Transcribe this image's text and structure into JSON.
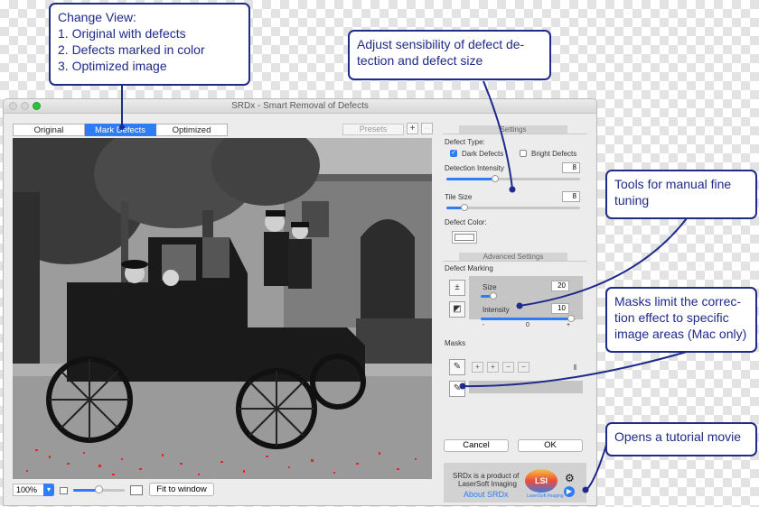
{
  "window": {
    "title": "SRDx - Smart Removal of Defects"
  },
  "tabs": [
    {
      "label": "Original",
      "active": false
    },
    {
      "label": "Mark Defects",
      "active": true
    },
    {
      "label": "Optimized",
      "active": false
    }
  ],
  "toolbar": {
    "presets_label": "Presets",
    "add_label": "+",
    "more_label": "···"
  },
  "settings": {
    "section_title": "Settings",
    "defect_type_label": "Defect Type:",
    "dark_defects_label": "Dark Defects",
    "dark_defects_checked": true,
    "bright_defects_label": "Bright Defects",
    "bright_defects_checked": false,
    "detection_intensity_label": "Detection Intensity",
    "detection_intensity_value": "8",
    "tile_size_label": "Tile Size",
    "tile_size_value": "8",
    "defect_color_label": "Defect Color:"
  },
  "advanced": {
    "section_title": "Advanced Settings",
    "defect_marking_label": "Defect Marking",
    "size_label": "Size",
    "size_value": "20",
    "intensity_label": "Intensity",
    "intensity_value": "10",
    "minus_label": "-",
    "zero_label": "0",
    "plus_label": "+",
    "masks_label": "Masks"
  },
  "buttons": {
    "cancel_label": "Cancel",
    "ok_label": "OK",
    "fit_label": "Fit to window"
  },
  "zoom": {
    "value": "100%"
  },
  "footer": {
    "product_line1": "SRDx is a product of",
    "product_line2": "LaserSoft Imaging",
    "about_label": "About SRDx",
    "logo_text": "LSI",
    "logo_sub": "LaserSoft Imaging"
  },
  "callouts": {
    "change_view": [
      "Change View:",
      "1. Original with defects",
      "2. Defects marked in color",
      "3. Optimized image"
    ],
    "adjust": [
      "Adjust sensibility of defect de-",
      "tection and defect size"
    ],
    "tools": [
      "Tools for manual fine",
      "tuning"
    ],
    "masks": [
      "Masks limit the correc-",
      "tion effect to specific",
      "image areas (Mac only)"
    ],
    "tutorial": [
      "Opens a tutorial movie"
    ]
  },
  "colors": {
    "accent": "#2f7df6",
    "callout": "#1f2a8a",
    "defect_marks": "#e8232a"
  },
  "icons": {
    "close": "close-icon",
    "gear": "gear-icon",
    "tutorial": "tutorial-icon",
    "brush": "brush-icon",
    "eraser": "eraser-icon",
    "plus_minus": "plus-minus-icon",
    "trash": "trash-icon"
  }
}
